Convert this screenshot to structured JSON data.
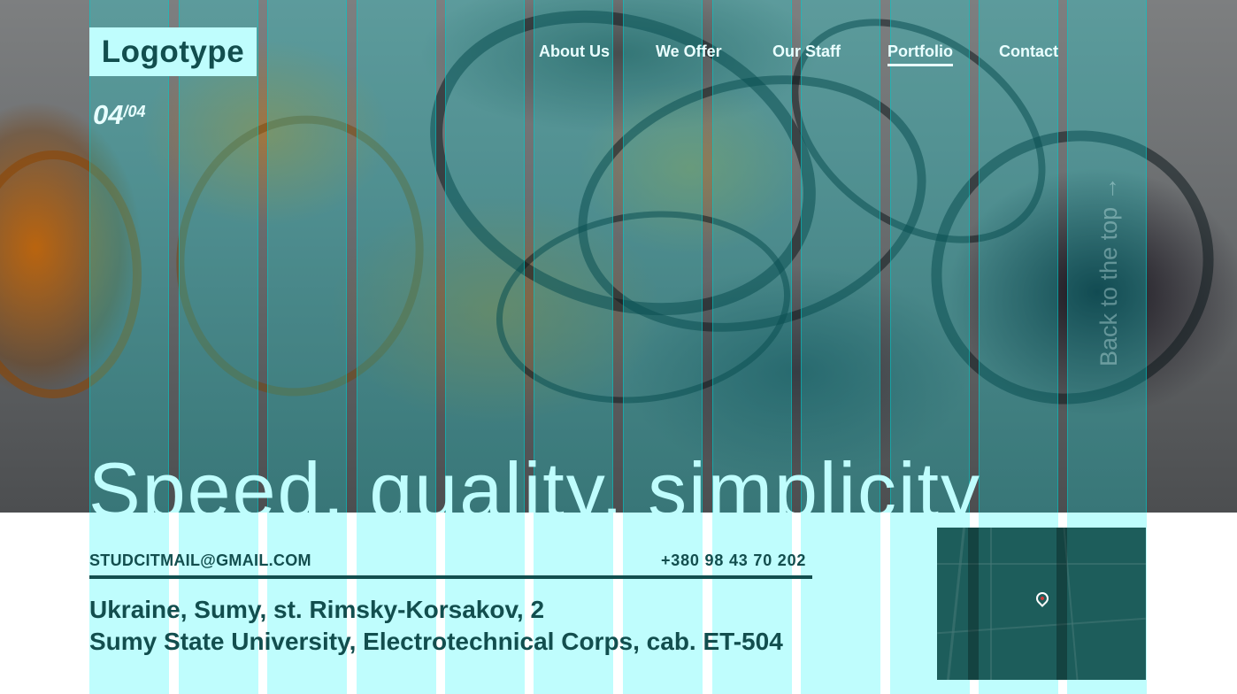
{
  "header": {
    "logo": "Logotype",
    "page_current": "04",
    "page_total": "/04"
  },
  "nav": {
    "items": [
      {
        "label": "About Us"
      },
      {
        "label": "We Offer"
      },
      {
        "label": "Our Staff"
      },
      {
        "label": "Portfolio",
        "active": true
      },
      {
        "label": "Contact"
      }
    ]
  },
  "hero": {
    "title": "Speed, quality, simplicity",
    "back_to_top": "Back to the top →"
  },
  "contacts": {
    "email": "STUDCITMAIL@GMAIL.COM",
    "phone": "+380 98 43 70 202",
    "address_line1": "Ukraine, Sumy, st. Rimsky-Korsakov, 2",
    "address_line2": "Sumy State University, Electrotechnical Corps, cab. ET-504"
  },
  "map": {
    "icon": "map-pin-icon"
  },
  "colors": {
    "accent": "#bffdfd",
    "text_dark": "#124e4e",
    "grid_overlay": "#00ebeb"
  }
}
